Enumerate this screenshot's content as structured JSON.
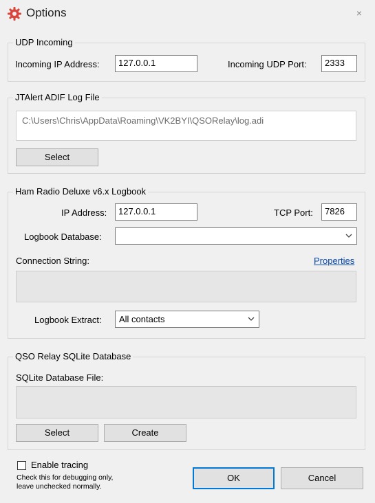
{
  "window": {
    "title": "Options",
    "close_glyph": "×"
  },
  "udp": {
    "legend": "UDP Incoming",
    "ip_label": "Incoming IP Address:",
    "ip_value": "127.0.0.1",
    "port_label": "Incoming UDP Port:",
    "port_value": "2333"
  },
  "adif": {
    "legend": "JTAlert ADIF Log File",
    "path": "C:\\Users\\Chris\\AppData\\Roaming\\VK2BYI\\QSORelay\\log.adi",
    "select_label": "Select"
  },
  "hrd": {
    "legend": "Ham Radio Deluxe v6.x Logbook",
    "ip_label": "IP Address:",
    "ip_value": "127.0.0.1",
    "port_label": "TCP Port:",
    "port_value": "7826",
    "db_label": "Logbook Database:",
    "db_value": "",
    "conn_label": "Connection String:",
    "properties_label": "Properties",
    "extract_label": "Logbook Extract:",
    "extract_value": "All contacts"
  },
  "sqlite": {
    "legend": "QSO Relay SQLite Database",
    "file_label": "SQLite Database File:",
    "select_label": "Select",
    "create_label": "Create"
  },
  "footer": {
    "tracing_label": "Enable tracing",
    "tracing_checked": false,
    "tracing_help_1": "Check this for debugging only,",
    "tracing_help_2": "leave unchecked normally.",
    "ok_label": "OK",
    "cancel_label": "Cancel"
  },
  "colors": {
    "gear_icon": "#d9453b",
    "link": "#0645ad",
    "ok_border": "#0078d7"
  },
  "icons": [
    "gear-icon",
    "close-icon",
    "chevron-down-icon"
  ]
}
